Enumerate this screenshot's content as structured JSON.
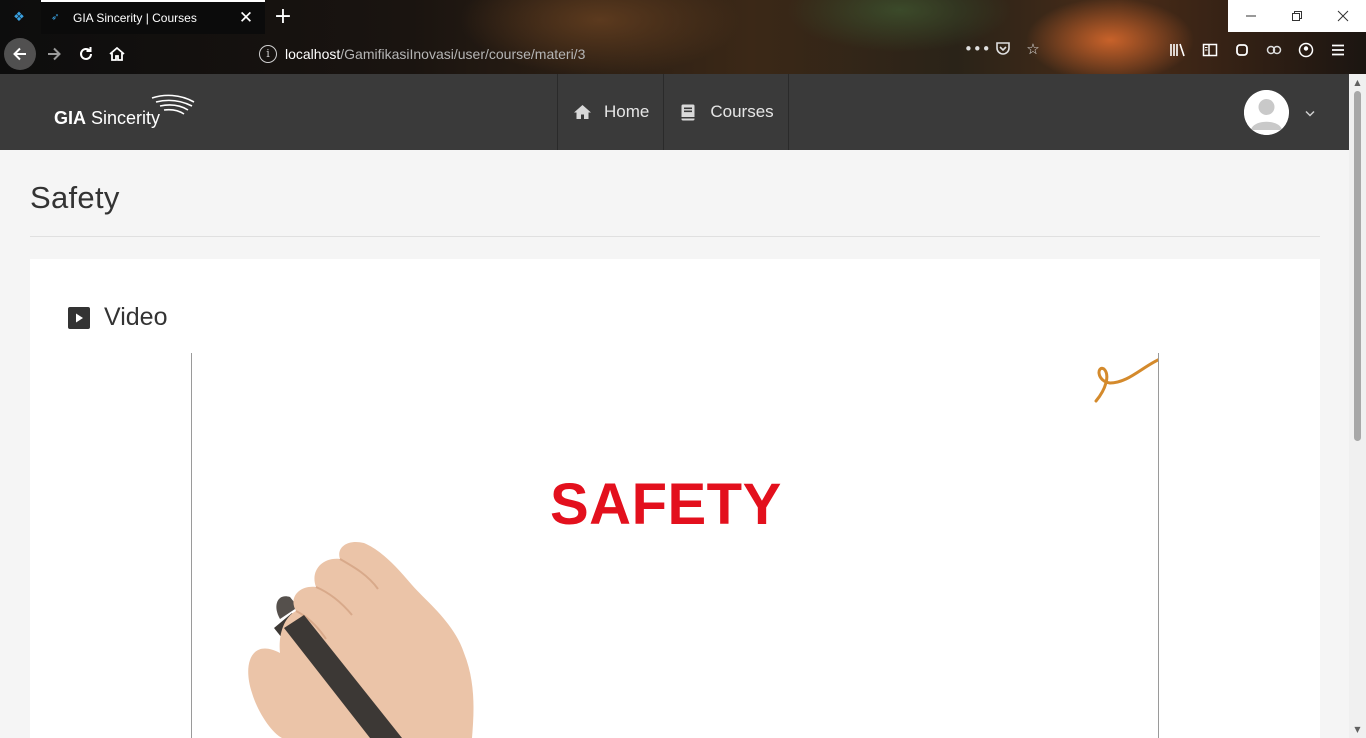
{
  "browser": {
    "tab_title": "GIA Sincerity | Courses",
    "url_host": "localhost",
    "url_path": "/GamifikasiInovasi/user/course/materi/3"
  },
  "site": {
    "logo_bold": "GIA",
    "logo_text": "Sincerity",
    "nav": [
      {
        "label": "Home",
        "icon": "home-icon"
      },
      {
        "label": "Courses",
        "icon": "book-icon"
      }
    ]
  },
  "page": {
    "title": "Safety",
    "section_title": "Video",
    "video_text": "SAFETY"
  },
  "colors": {
    "header_bg": "#3a3a3a",
    "page_bg": "#f5f5f5",
    "video_text": "#e3101d"
  }
}
